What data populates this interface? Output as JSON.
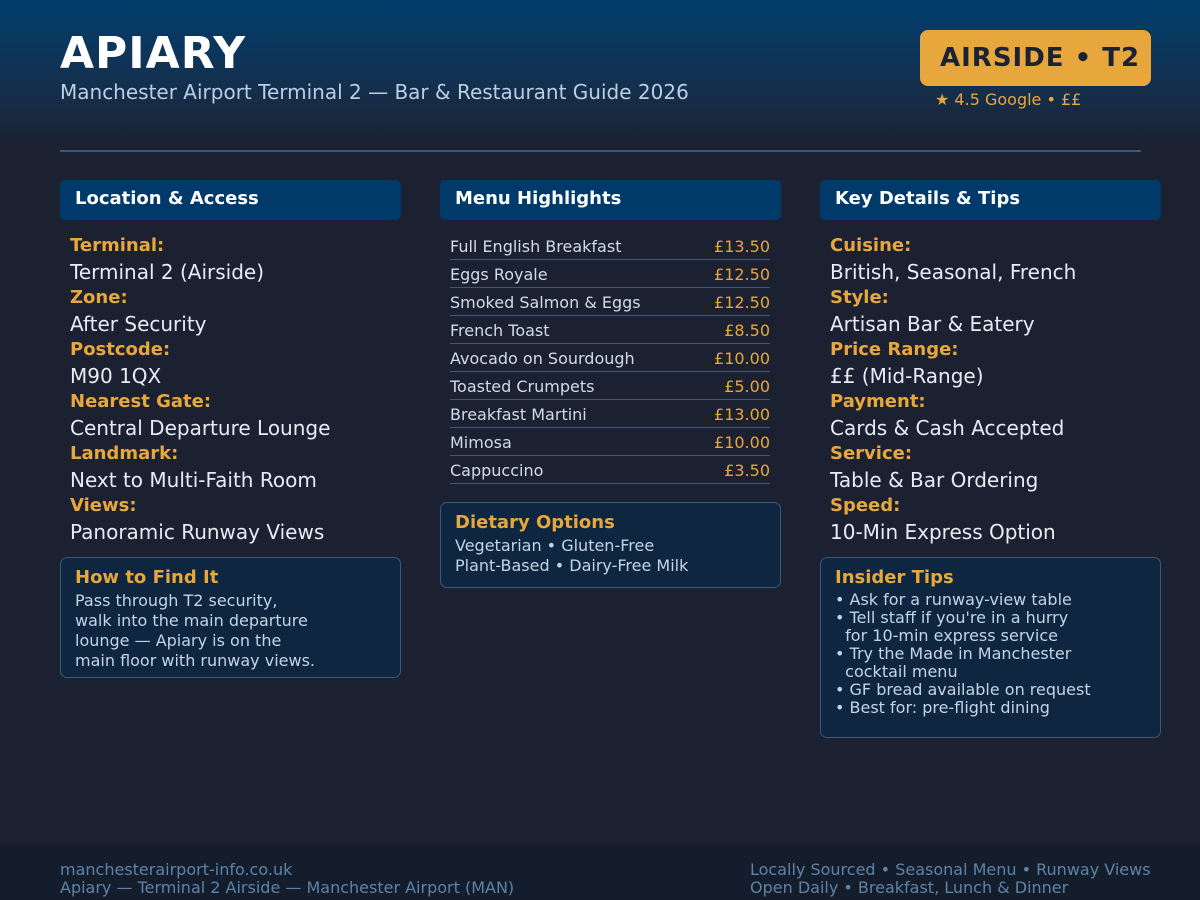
{
  "header": {
    "title": "APIARY",
    "subtitle": "Manchester Airport Terminal 2 — Bar & Restaurant Guide 2026",
    "badge": "AIRSIDE  •  T2",
    "rating": "★ 4.5 Google  •  ££"
  },
  "location": {
    "heading": "Location & Access",
    "fields": [
      {
        "label": "Terminal:",
        "value": "Terminal 2 (Airside)"
      },
      {
        "label": "Zone:",
        "value": "After Security"
      },
      {
        "label": "Postcode:",
        "value": "M90 1QX"
      },
      {
        "label": "Nearest Gate:",
        "value": "Central Departure Lounge"
      },
      {
        "label": "Landmark:",
        "value": "Next to Multi-Faith Room"
      },
      {
        "label": "Views:",
        "value": "Panoramic Runway Views"
      }
    ],
    "find_it": {
      "title": "How to Find It",
      "lines": [
        "Pass through T2 security,",
        "walk into the main departure",
        "lounge — Apiary is on the",
        "main floor with runway views."
      ]
    }
  },
  "menu": {
    "heading": "Menu Highlights",
    "items": [
      {
        "name": "Full English Breakfast",
        "price": "£13.50"
      },
      {
        "name": "Eggs Royale",
        "price": "£12.50"
      },
      {
        "name": "Smoked Salmon & Eggs",
        "price": "£12.50"
      },
      {
        "name": "French Toast",
        "price": "£8.50"
      },
      {
        "name": "Avocado on Sourdough",
        "price": "£10.00"
      },
      {
        "name": "Toasted Crumpets",
        "price": "£5.00"
      },
      {
        "name": "Breakfast Martini",
        "price": "£13.00"
      },
      {
        "name": "Mimosa",
        "price": "£10.00"
      },
      {
        "name": "Cappuccino",
        "price": "£3.50"
      }
    ],
    "dietary": {
      "title": "Dietary Options",
      "lines": [
        "Vegetarian • Gluten-Free",
        "Plant-Based • Dairy-Free Milk"
      ]
    }
  },
  "details": {
    "heading": "Key Details & Tips",
    "fields": [
      {
        "label": "Cuisine:",
        "value": "British, Seasonal, French"
      },
      {
        "label": "Style:",
        "value": "Artisan Bar & Eatery"
      },
      {
        "label": "Price Range:",
        "value": "££ (Mid-Range)"
      },
      {
        "label": "Payment:",
        "value": "Cards & Cash Accepted"
      },
      {
        "label": "Service:",
        "value": "Table & Bar Ordering"
      },
      {
        "label": "Speed:",
        "value": "10-Min Express Option"
      }
    ],
    "tips": {
      "title": "Insider Tips",
      "lines": [
        "• Ask for a runway-view table",
        "• Tell staff if you're in a hurry",
        "  for 10-min express service",
        "• Try the Made in Manchester",
        "  cocktail menu",
        "• GF bread available on request",
        "• Best for: pre-flight dining"
      ]
    }
  },
  "footer": {
    "website": "manchesterairport-info.co.uk",
    "location_line": "Apiary — Terminal 2 Airside — Manchester Airport (MAN)",
    "features": "Locally Sourced  •  Seasonal Menu  •  Runway Views",
    "hours": "Open Daily  •  Breakfast, Lunch & Dinner"
  },
  "colors": {
    "background": "#1b2130",
    "header_blue": "#003f6e",
    "accent_gold": "#e8a73c",
    "panel_navy": "#0e2640"
  }
}
